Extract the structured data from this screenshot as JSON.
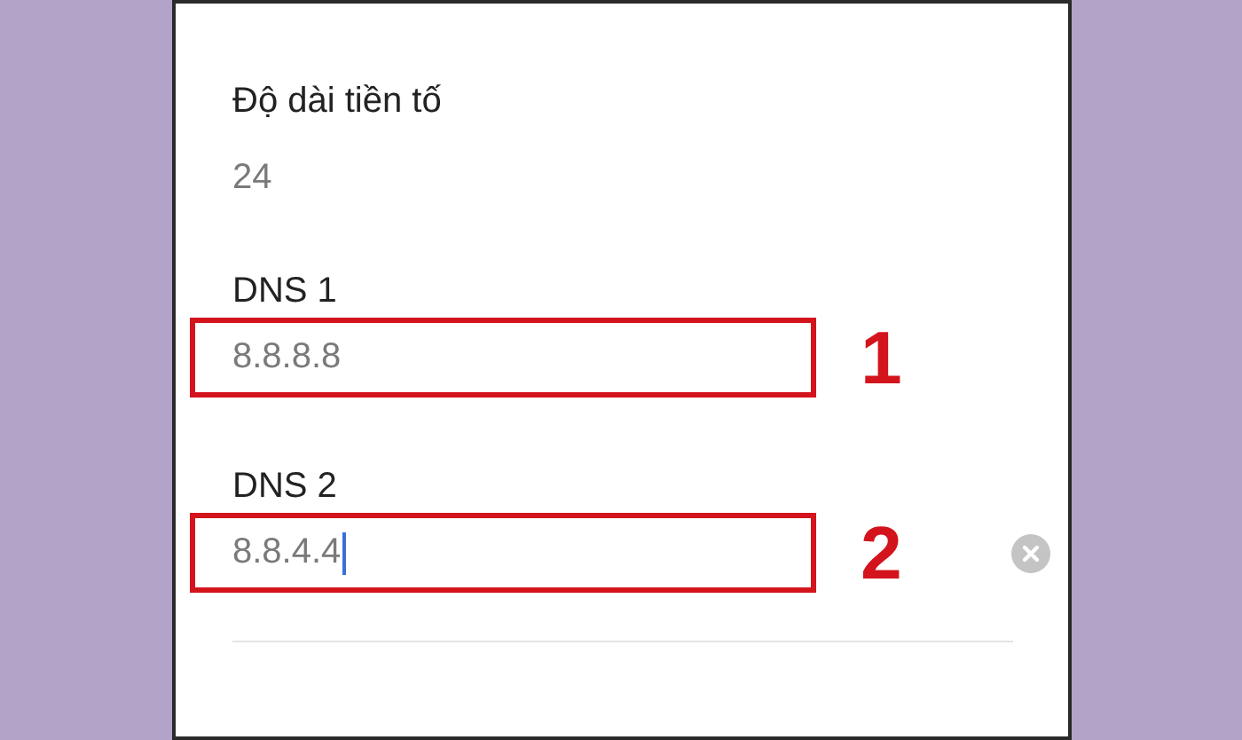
{
  "prefix_length": {
    "label": "Độ dài tiền tố",
    "value": "24"
  },
  "dns_fields": [
    {
      "label": "DNS 1",
      "value": "8.8.8.8",
      "highlighted": true,
      "focused": false,
      "annotation": "1"
    },
    {
      "label": "DNS 2",
      "value": "8.8.4.4",
      "highlighted": true,
      "focused": true,
      "annotation": "2"
    }
  ]
}
